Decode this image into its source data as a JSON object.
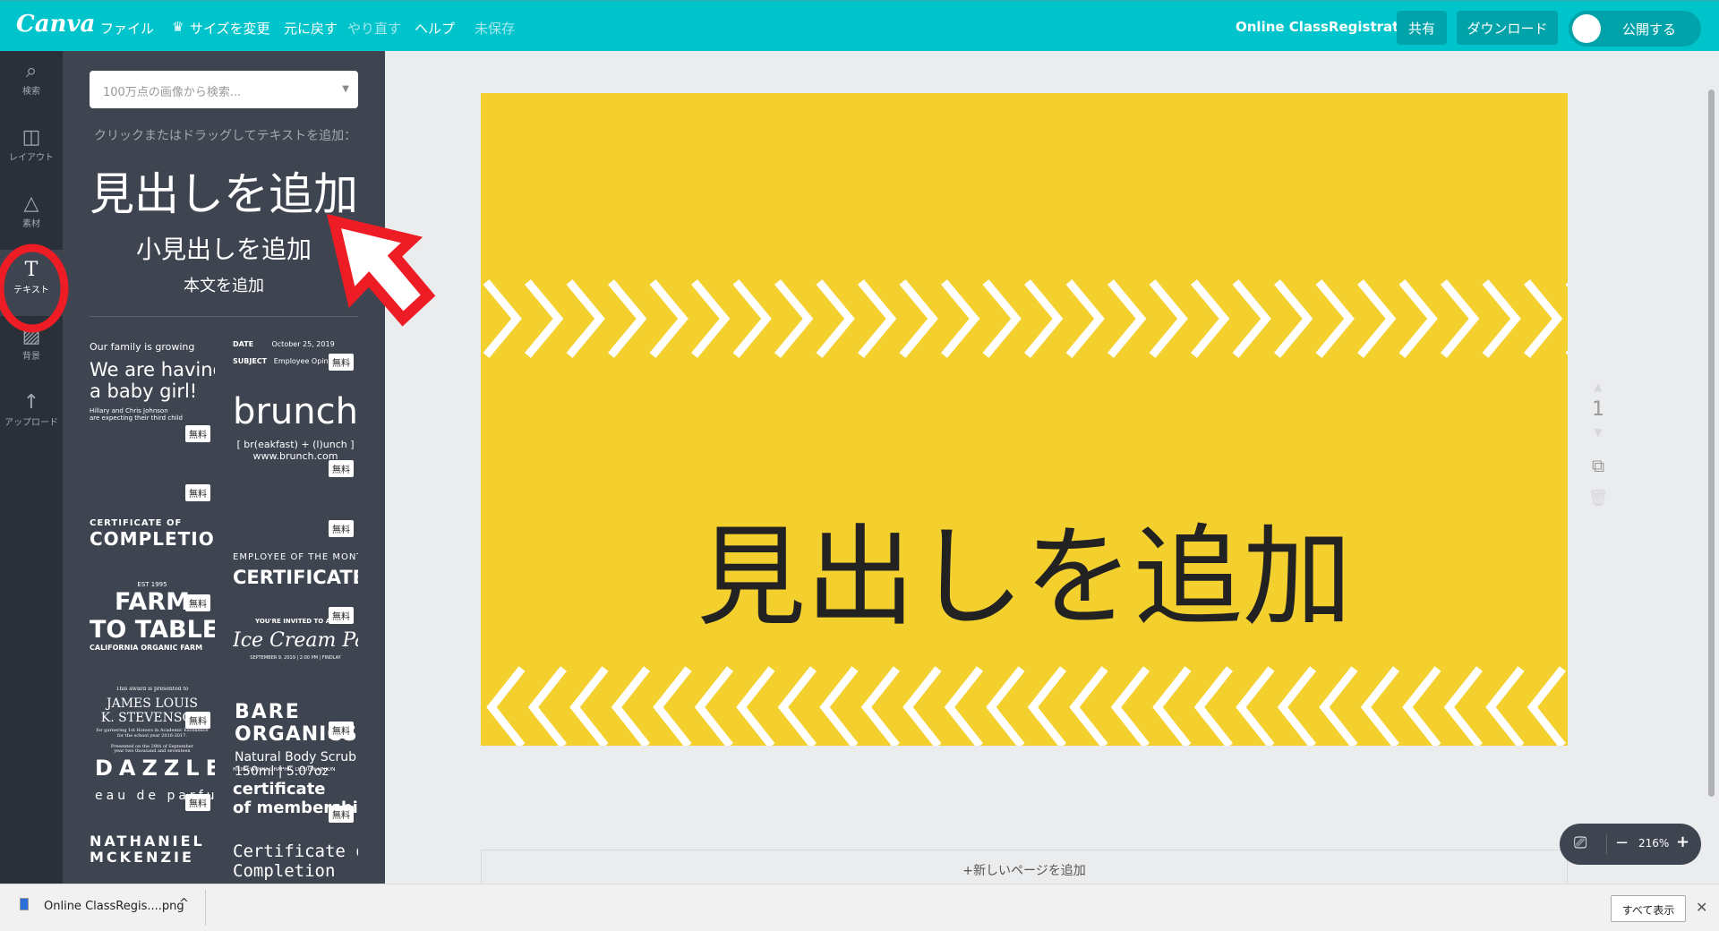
{
  "topbar": {
    "logo": "Canva",
    "menu": [
      "ファイル",
      "サイズを変更",
      "元に戻す",
      "やり直す",
      "ヘルプ",
      "未保存"
    ],
    "doc_title": "Online ClassRegistration",
    "share": "共有",
    "download": "ダウンロード",
    "publish": "公開する",
    "color": "#00c4cc"
  },
  "rail": [
    {
      "icon": "search-icon",
      "label": "検索"
    },
    {
      "icon": "layout-icon",
      "label": "レイアウト"
    },
    {
      "icon": "elements-icon",
      "label": "素材"
    },
    {
      "icon": "text-icon",
      "label": "テキスト"
    },
    {
      "icon": "background-icon",
      "label": "背景"
    },
    {
      "icon": "upload-icon",
      "label": "アップロード"
    }
  ],
  "panel": {
    "search_placeholder": "100万点の画像から検索...",
    "hint": "クリックまたはドラッグしてテキストを追加：",
    "heading": "見出しを追加",
    "subheading": "小見出しを追加",
    "body": "本文を追加",
    "free_badge": "無料",
    "templates": {
      "baby": [
        "Our family is growing",
        "We are having",
        "a baby girl!",
        "Hillary and Chris Johnson",
        "are expecting their third child"
      ],
      "memo": [
        "DATE",
        "October 25, 2019",
        "SUBJECT",
        "Employee Opinion"
      ],
      "brunch": [
        "brunch",
        "[ br(eakfast) + (l)unch ]",
        "www.brunch.com"
      ],
      "cert": [
        "CERTIFICATE OF",
        "COMPLETION"
      ],
      "employee": [
        "EMPLOYEE OF THE MONTH",
        "CERTIFICATE"
      ],
      "farm": [
        "EST 1995",
        "FARM",
        "TO TABLE",
        "CALIFORNIA ORGANIC FARM"
      ],
      "icecream": [
        "YOU'RE INVITED TO AN",
        "Ice Cream Party",
        "SEPTEMBER 9, 2019 | 2:00 PM | FINDLAY"
      ],
      "award": [
        "This award is presented to",
        "JAMES LOUIS",
        "K. STEVENSON",
        "for garnering 1st Honors in Academic Excellence",
        "for the school year 2016-2017.",
        "Presented on the 28th of September",
        "year two thousand and seventeen"
      ],
      "bare": [
        "BARE",
        "ORGANICS",
        "Natural Body Scrub",
        "150ml | 5.07oz"
      ],
      "dazzle": [
        "DAZZLE",
        "eau de parfum"
      ],
      "ridgewood": [
        "RIDGEWOOD GRAPHIC DESIGN UNION",
        "certificate",
        "of membership"
      ],
      "nathaniel": [
        "NATHANIEL",
        "MCKENZIE"
      ],
      "completion": [
        "Certificate of",
        "Completion"
      ]
    }
  },
  "design": {
    "heading": "見出しを追加",
    "background": "#f4d02e",
    "add_page": "+新しいページを追加"
  },
  "page_controls": {
    "page_number": "1"
  },
  "zoom": {
    "level": "216%",
    "minus": "−",
    "plus": "+"
  },
  "download_bar": {
    "file": "Online ClassRegis....png",
    "show_all": "すべて表示",
    "close": "✕"
  }
}
